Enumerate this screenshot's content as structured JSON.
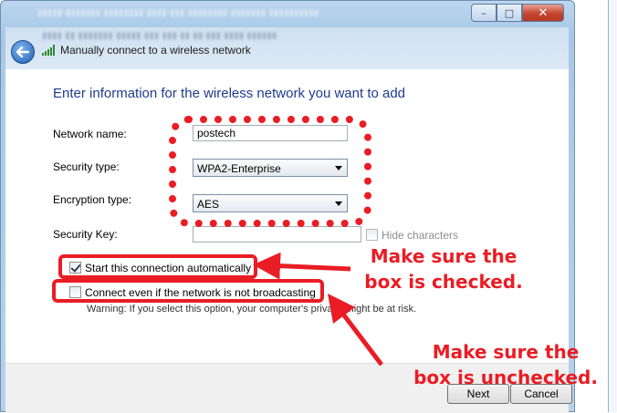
{
  "window": {
    "caption_buttons": {
      "minimize": "–",
      "maximize": "□",
      "close": "✕"
    }
  },
  "header": {
    "title": "Manually connect to a wireless network",
    "icons": {
      "back": "back-arrow-icon",
      "signal": "wireless-signal-icon"
    }
  },
  "form": {
    "heading": "Enter information for the wireless network you want to add",
    "network_name": {
      "label": "Network name:",
      "value": "postech"
    },
    "security_type": {
      "label": "Security type:",
      "value": "WPA2-Enterprise"
    },
    "encryption_type": {
      "label": "Encryption type:",
      "value": "AES"
    },
    "security_key": {
      "label": "Security Key:",
      "value": ""
    },
    "hide_characters": {
      "label": "Hide characters",
      "checked": false
    },
    "start_automatically": {
      "label": "Start this connection automatically",
      "checked": true
    },
    "connect_not_broadcasting": {
      "label": "Connect even if the network is not broadcasting",
      "checked": false
    },
    "warning": "Warning: If you select this option, your computer's privacy might be at risk."
  },
  "buttons": {
    "next": "Next",
    "cancel": "Cancel"
  },
  "annotations": {
    "callout_checked_line1": "Make sure the",
    "callout_checked_line2": "box is checked.",
    "callout_unchecked_line1": "Make sure the",
    "callout_unchecked_line2": "box is unchecked.",
    "color": "#ea1c24"
  }
}
